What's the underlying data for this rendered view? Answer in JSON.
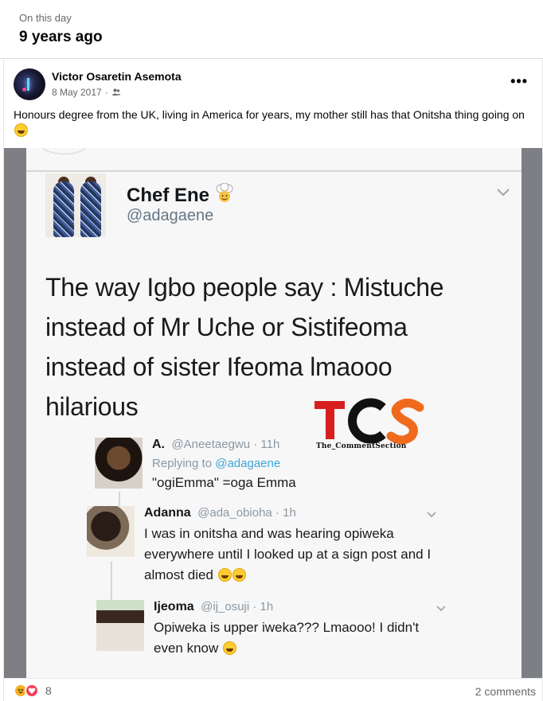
{
  "memory": {
    "label": "On this day",
    "title": "9 years ago"
  },
  "post": {
    "author": "Victor Osaretin Asemota",
    "date": "8 May 2017",
    "separator": "·",
    "audience_icon": "friends-icon",
    "more_label": "•••",
    "caption": "Honours degree from the UK, living in America for years, my mother still has that Onitsha thing going on"
  },
  "tweet": {
    "name": "Chef Ene",
    "handle": "@adagaene",
    "text": "The way Igbo people say : Mistuche instead of Mr Uche or Sistifeoma instead of sister Ifeoma lmaooo hilarious",
    "watermark": "TCS",
    "watermark_sub": "The_CommentSection"
  },
  "replies": [
    {
      "name": "A.",
      "handle": "@Aneetaegwu · 11h",
      "replying_prefix": "Replying to ",
      "replying_to": "@adagaene",
      "text": "\"ogiEmma\" =oga Emma"
    },
    {
      "name": "Adanna",
      "handle": "@ada_obioha · 1h",
      "text": "I was in onitsha and was hearing opiweka everywhere until I looked up at a sign post and I almost died"
    },
    {
      "name": "Ijeoma",
      "handle": "@ij_osuji · 1h",
      "text": "Opiweka is upper iweka??? Lmaooo! I didn't even know"
    }
  ],
  "footer": {
    "reaction_count": "8",
    "comments": "2 comments"
  },
  "colors": {
    "haha": "#f7b125",
    "love": "#f33e58",
    "secondary_text": "#65676b",
    "link": "#3ea4d8"
  }
}
